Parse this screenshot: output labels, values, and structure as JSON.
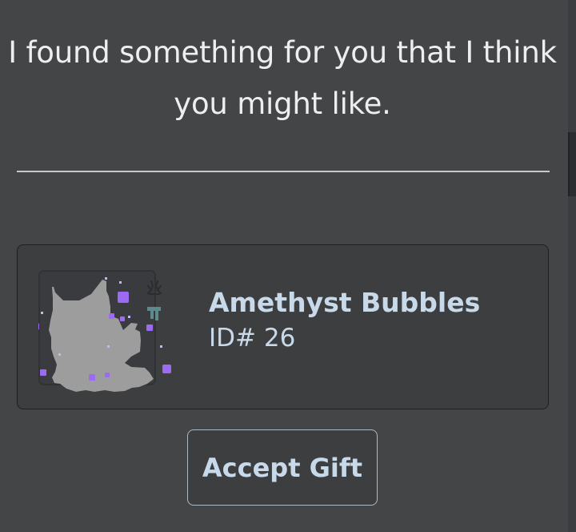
{
  "message": {
    "line1": "I found something for you that I think",
    "line2": "you might like."
  },
  "gift": {
    "name": "Amethyst Bubbles",
    "id_label": "ID# 26",
    "image": "grey-cat-with-amethyst-bubbles"
  },
  "actions": {
    "accept_label": "Accept Gift"
  },
  "colors": {
    "background": "#444547",
    "card": "#3d3e40",
    "accent_text": "#c8d9ea",
    "bubble": "#9b6cf2"
  }
}
